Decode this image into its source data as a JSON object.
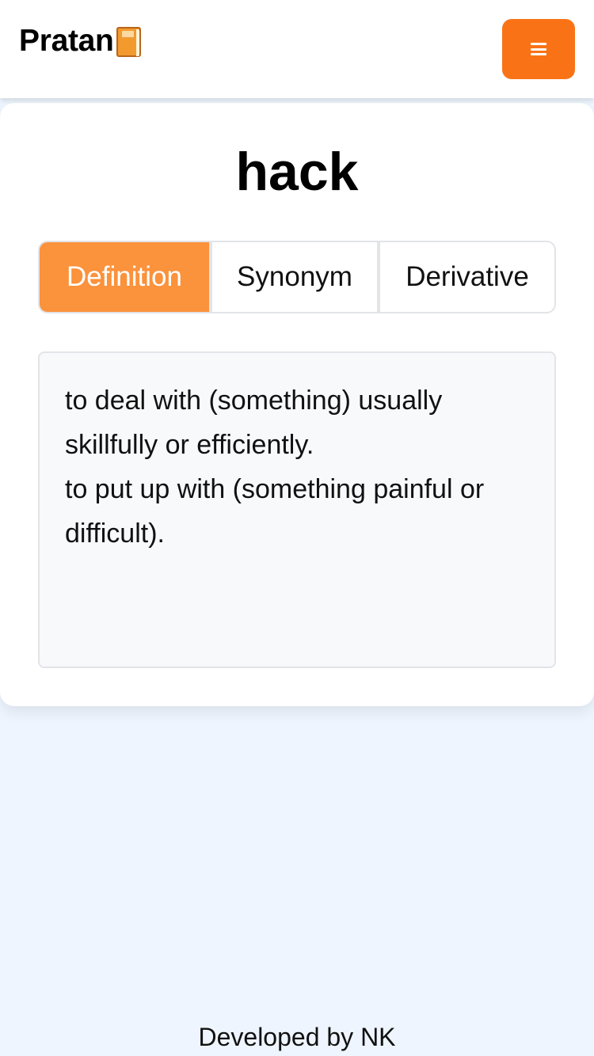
{
  "navbar": {
    "brand": "Pratan",
    "brand_icon": "book-icon",
    "menu_icon": "hamburger-icon",
    "accent_color": "#f97316"
  },
  "word": {
    "title": "hack"
  },
  "tabs": [
    {
      "label": "Definition",
      "active": true
    },
    {
      "label": "Synonym",
      "active": false
    },
    {
      "label": "Derivative",
      "active": false
    }
  ],
  "active_tab_color": "#fb923c",
  "definition": {
    "lines": [
      "to deal with (something) usually skillfully or efficiently.",
      "to put up with (something painful or difficult)."
    ]
  },
  "footer": {
    "text": "Developed by NK"
  }
}
